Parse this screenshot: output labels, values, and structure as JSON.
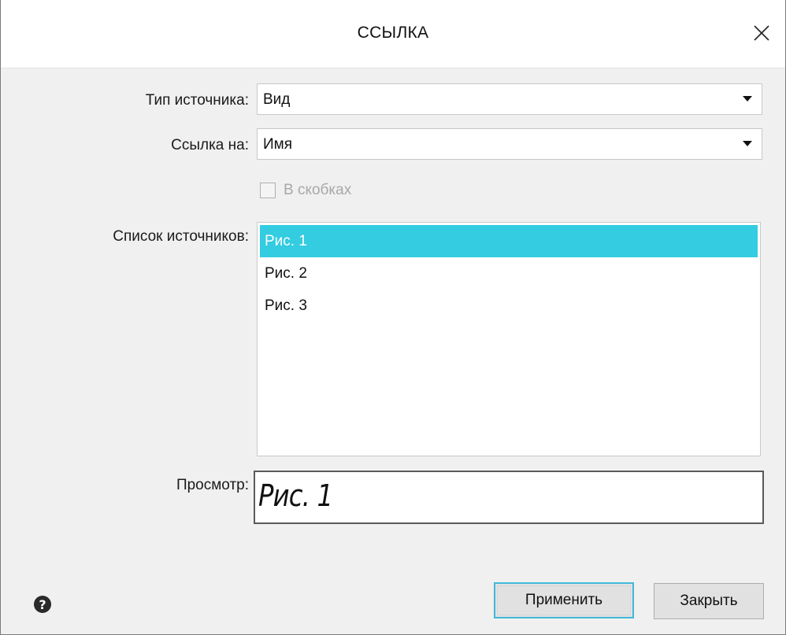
{
  "window": {
    "title": "ССЫЛКА",
    "close_icon": "close-icon"
  },
  "form": {
    "source_type": {
      "label": "Тип источника:",
      "value": "Вид"
    },
    "reference_to": {
      "label": "Ссылка на:",
      "value": "Имя"
    },
    "in_brackets": {
      "label": "В скобках",
      "checked": false,
      "disabled": true
    },
    "source_list": {
      "label": "Список источников:",
      "items": [
        {
          "label": "Рис. 1",
          "selected": true
        },
        {
          "label": "Рис. 2",
          "selected": false
        },
        {
          "label": "Рис. 3",
          "selected": false
        }
      ]
    },
    "preview": {
      "label": "Просмотр:",
      "value": "Рис. 1"
    }
  },
  "footer": {
    "help_icon": "question-circle-icon",
    "apply_label": "Применить",
    "close_label": "Закрыть"
  },
  "colors": {
    "selection": "#33cce0",
    "focus_border": "#40b8d8",
    "dialog_bg": "#f0f0f0"
  }
}
